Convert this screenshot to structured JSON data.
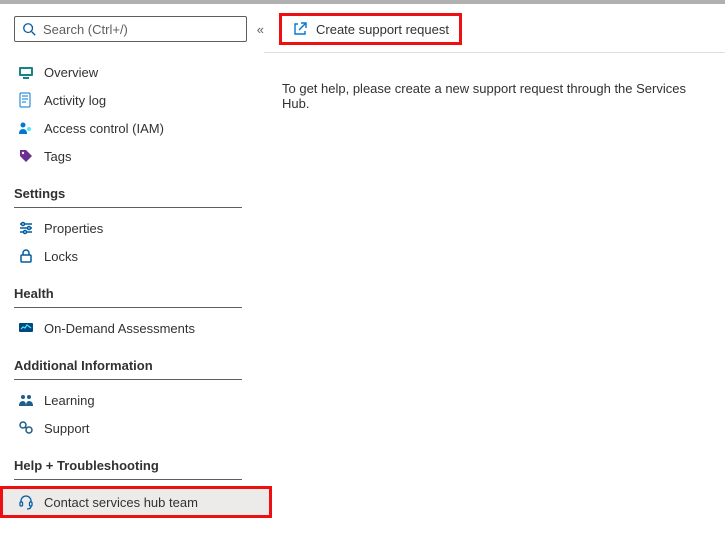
{
  "search": {
    "placeholder": "Search (Ctrl+/)"
  },
  "primaryNav": {
    "overview": "Overview",
    "activityLog": "Activity log",
    "accessControl": "Access control (IAM)",
    "tags": "Tags"
  },
  "sections": {
    "settings": {
      "header": "Settings",
      "properties": "Properties",
      "locks": "Locks"
    },
    "health": {
      "header": "Health",
      "onDemand": "On-Demand Assessments"
    },
    "additional": {
      "header": "Additional Information",
      "learning": "Learning",
      "support": "Support"
    },
    "help": {
      "header": "Help + Troubleshooting",
      "contact": "Contact services hub team"
    }
  },
  "actionBar": {
    "createRequest": "Create support request"
  },
  "content": {
    "helpText": "To get help, please create a new support request through the Services Hub."
  }
}
